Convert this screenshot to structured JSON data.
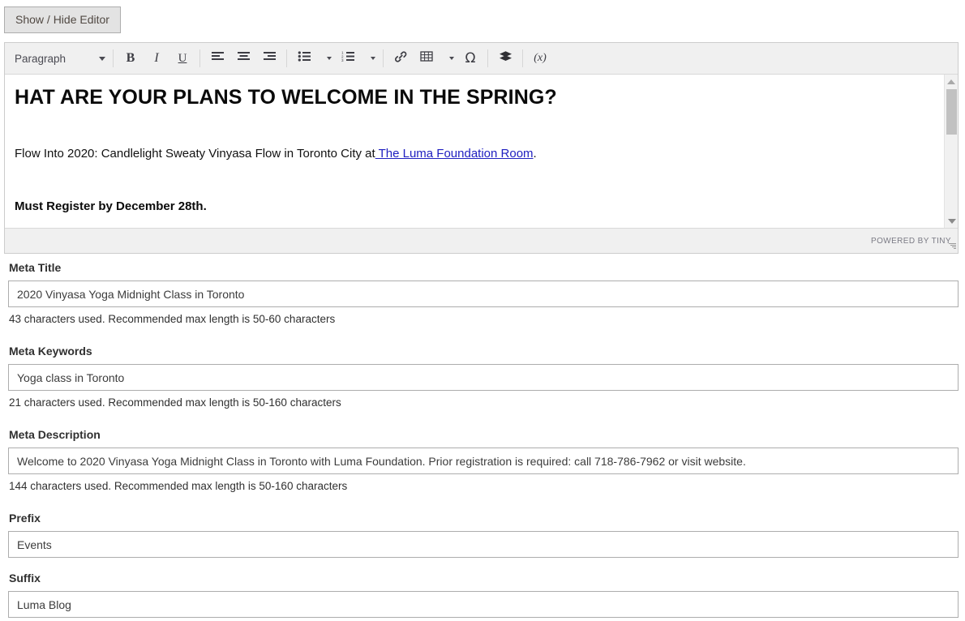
{
  "toolbar_top": {
    "show_hide_label": "Show / Hide Editor"
  },
  "editor": {
    "toolbar": {
      "format_select": "Paragraph",
      "bold": "B",
      "italic": "I",
      "underline": "U",
      "align_left": "align-left",
      "align_center": "align-center",
      "align_right": "align-right",
      "bullet_list": "bullet-list",
      "numbered_list": "numbered-list",
      "link": "link",
      "table": "table",
      "special_char": "Ω",
      "widget": "widget",
      "variable": "(x)"
    },
    "content": {
      "heading": "HAT ARE YOUR PLANS TO WELCOME IN THE SPRING?",
      "paragraph_pre_link": "Flow Into 2020: Candlelight Sweaty Vinyasa Flow in Toronto City at",
      "paragraph_link": " The Luma Foundation Room",
      "paragraph_post_link": ".",
      "bold_line": "Must Register by December 28th."
    },
    "status": {
      "powered_by": "POWERED BY TINY"
    }
  },
  "fields": [
    {
      "label": "Meta Title",
      "value": "2020 Vinyasa Yoga Midnight Class in Toronto",
      "note": "43 characters used. Recommended max length is 50-60 characters"
    },
    {
      "label": "Meta Keywords",
      "value": "Yoga class in Toronto",
      "note": "21 characters used. Recommended max length is 50-160 characters"
    },
    {
      "label": "Meta Description",
      "value": "Welcome to 2020 Vinyasa Yoga Midnight Class in Toronto with Luma Foundation. Prior registration is required: call 718-786-7962 or visit website.",
      "note": "144 characters used. Recommended max length is 50-160 characters"
    },
    {
      "label": "Prefix",
      "value": "Events",
      "note": ""
    },
    {
      "label": "Suffix",
      "value": "Luma Blog",
      "note": ""
    }
  ]
}
